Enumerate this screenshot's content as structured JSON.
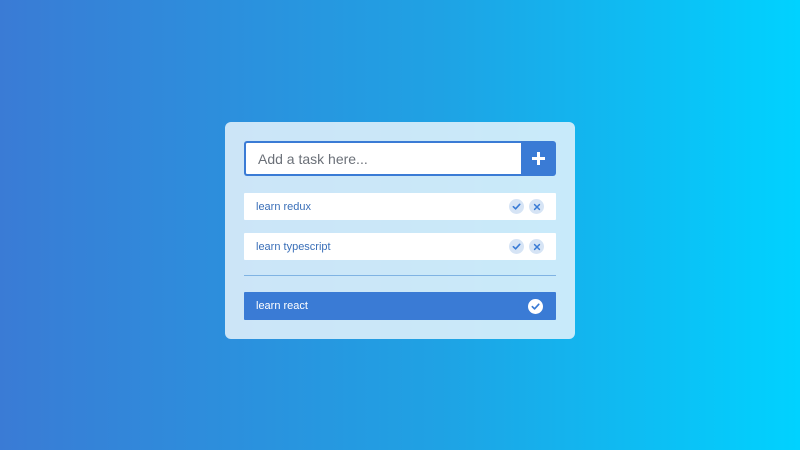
{
  "input": {
    "placeholder": "Add a task here...",
    "value": ""
  },
  "add_button": {
    "icon": "plus-icon"
  },
  "todo_items": [
    {
      "label": "learn redux",
      "icons": [
        "check-icon",
        "close-icon"
      ]
    },
    {
      "label": "learn typescript",
      "icons": [
        "check-icon",
        "close-icon"
      ]
    }
  ],
  "done_items": [
    {
      "label": "learn react",
      "icon": "check-circle-icon"
    }
  ],
  "colors": {
    "accent": "#3a7bd5",
    "gradient_start": "#3a7bd5",
    "gradient_end": "#00d2ff",
    "item_text": "#3a6fb8",
    "icon_bg": "#d6e4f5",
    "card_bg": "#e6f3fc"
  }
}
